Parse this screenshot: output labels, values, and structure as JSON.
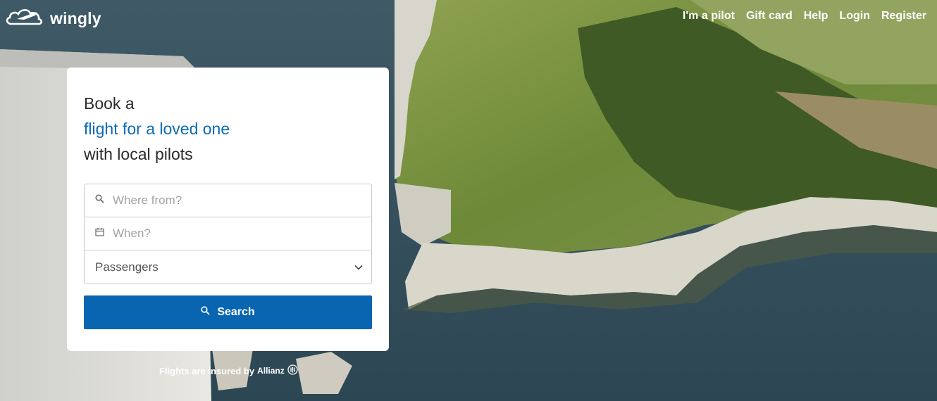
{
  "brand": {
    "name": "wingly"
  },
  "nav": {
    "items": [
      {
        "label": "I'm a pilot"
      },
      {
        "label": "Gift card"
      },
      {
        "label": "Help"
      },
      {
        "label": "Login"
      },
      {
        "label": "Register"
      }
    ]
  },
  "hero": {
    "line1": "Book a",
    "line2": "flight for a loved one",
    "line3": "with local pilots"
  },
  "search": {
    "from_placeholder": "Where from?",
    "when_placeholder": "When?",
    "passengers_label": "Passengers",
    "button_label": "Search"
  },
  "insurance": {
    "text": "Flights are insured by",
    "brand": "Allianz"
  },
  "colors": {
    "accent": "#0a6bb5",
    "button": "#0a65b0"
  }
}
